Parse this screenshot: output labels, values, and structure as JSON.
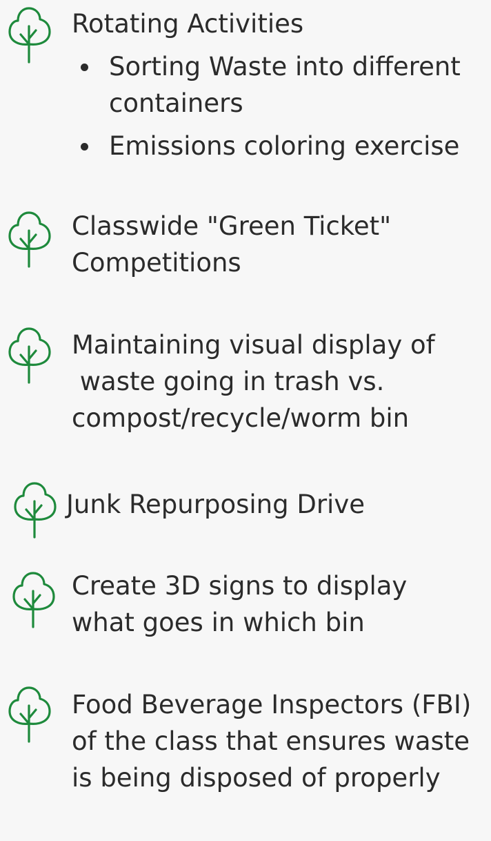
{
  "icon_name": "tree-icon",
  "icon_color": "#1e8a3c",
  "items": [
    {
      "text": "Rotating Activities",
      "subitems": [
        "Sorting Waste into different containers",
        "Emissions coloring exercise"
      ]
    },
    {
      "text": "Classwide \"Green Ticket\" Competitions"
    },
    {
      "text": "Maintaining visual display of\n waste going in trash vs.\ncompost/recycle/worm bin"
    },
    {
      "text": "Junk Repurposing Drive"
    },
    {
      "text": "Create 3D signs to display what goes in which bin"
    },
    {
      "text": "Food Beverage Inspectors (FBI) of the class that ensures waste is being disposed of properly"
    }
  ]
}
